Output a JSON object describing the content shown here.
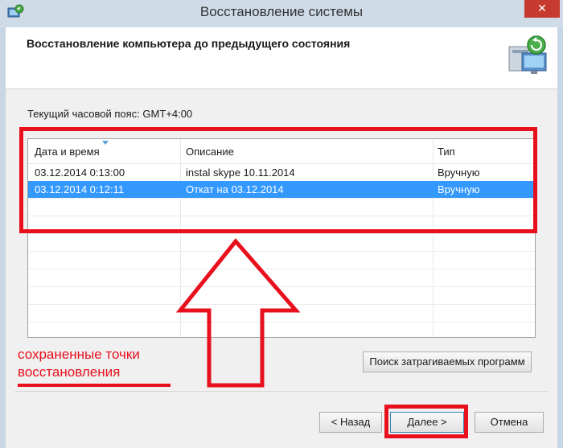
{
  "window": {
    "title": "Восстановление системы",
    "close_glyph": "✕"
  },
  "header": {
    "title": "Восстановление компьютера до предыдущего состояния"
  },
  "timezone_label": "Текущий часовой пояс: GMT+4:00",
  "table": {
    "columns": [
      "Дата и время",
      "Описание",
      "Тип"
    ],
    "rows": [
      {
        "datetime": "03.12.2014 0:13:00",
        "description": "instal skype 10.11.2014",
        "type": "Вручную",
        "selected": false
      },
      {
        "datetime": "03.12.2014 0:12:11",
        "description": "Откат на 03.12.2014",
        "type": "Вручную",
        "selected": true
      }
    ]
  },
  "buttons": {
    "scan": "Поиск затрагиваемых программ",
    "back": "< Назад",
    "next": "Далее >",
    "cancel": "Отмена"
  },
  "annotation": {
    "line1": "сохраненные точки",
    "line2": "восстановления"
  },
  "colors": {
    "annotation": "#e8101c",
    "selection": "#3399ff",
    "close_button": "#c73a2f"
  },
  "icons": [
    "system-restore-icon",
    "restore-computer-icon",
    "sort-arrow-icon"
  ]
}
